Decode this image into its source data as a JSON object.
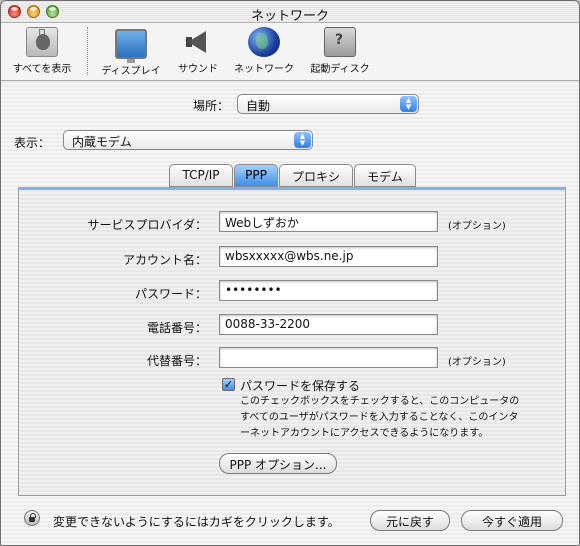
{
  "window": {
    "title": "ネットワーク"
  },
  "toolbar": {
    "items": [
      {
        "label": "すべてを表示",
        "icon": "show-all-icon"
      },
      {
        "label": "ディスプレイ",
        "icon": "display-icon"
      },
      {
        "label": "サウンド",
        "icon": "sound-icon"
      },
      {
        "label": "ネットワーク",
        "icon": "network-globe-icon"
      },
      {
        "label": "起動ディスク",
        "icon": "startup-disk-icon"
      }
    ]
  },
  "location": {
    "label": "場所：",
    "value": "自動"
  },
  "show": {
    "label": "表示：",
    "value": "内蔵モデム"
  },
  "tabs": [
    {
      "label": "TCP/IP",
      "active": false
    },
    {
      "label": "PPP",
      "active": true
    },
    {
      "label": "プロキシ",
      "active": false
    },
    {
      "label": "モデム",
      "active": false
    }
  ],
  "form": {
    "service_provider": {
      "label": "サービスプロバイダ：",
      "value": "Webしずおか",
      "note": "(オプション)"
    },
    "account_name": {
      "label": "アカウント名：",
      "value": "wbsxxxxx@wbs.ne.jp"
    },
    "password": {
      "label": "パスワード：",
      "value": "••••••••"
    },
    "phone_number": {
      "label": "電話番号：",
      "value": "0088-33-2200"
    },
    "alt_number": {
      "label": "代替番号：",
      "value": "",
      "note": "(オプション)"
    },
    "save_password": {
      "label": "パスワードを保存する",
      "checked": true,
      "description": [
        "このチェックボックスをチェックすると、このコンピュータの",
        "すべてのユーザがパスワードを入力することなく、このインタ",
        "ーネットアカウントにアクセスできるようになります。"
      ]
    },
    "ppp_options_button": "PPP オプション..."
  },
  "footer": {
    "lock_text": "変更できないようにするにはカギをクリックします。",
    "revert_button": "元に戻す",
    "apply_button": "今すぐ適用"
  },
  "colors": {
    "accent": "#3e8fea",
    "panel_border": "#7fb1ea"
  }
}
